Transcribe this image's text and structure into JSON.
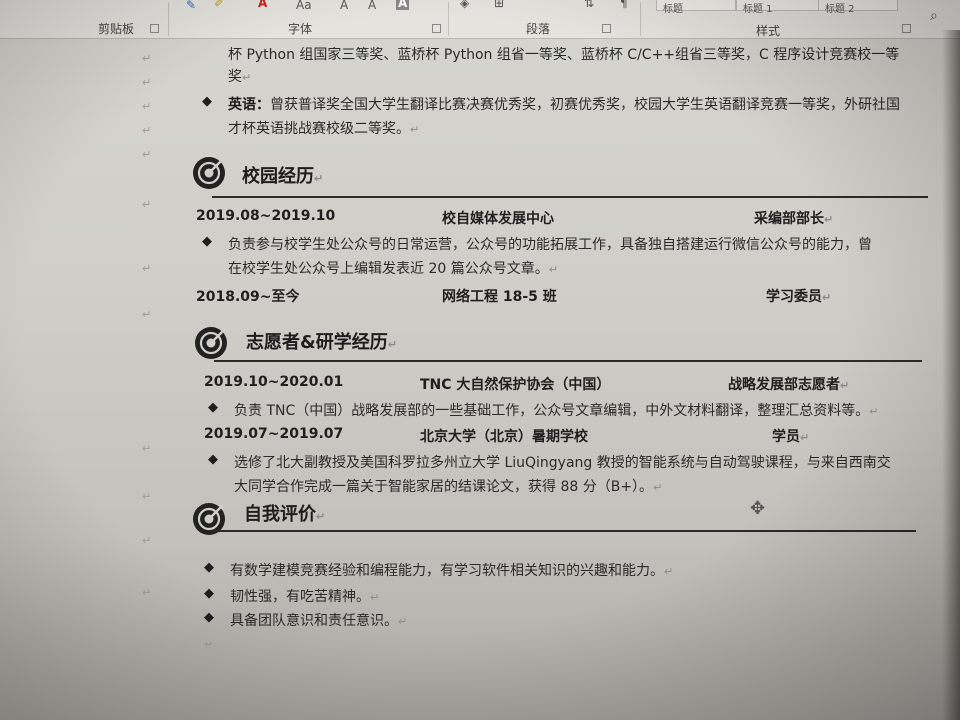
{
  "ribbon": {
    "clipboard_label": "剪贴板",
    "font_label": "字体",
    "paragraph_label": "段落",
    "styles_label": "样式",
    "font_size_tool": "Aa",
    "grow_font": "A",
    "shrink_font": "A",
    "styles": [
      "标题",
      "标题 1",
      "标题 2"
    ]
  },
  "awards": {
    "line1": "杯 Python 组国家三等奖、蓝桥杯 Python 组省一等奖、蓝桥杯 C/C++组省三等奖，C 程序设计竞赛校一等",
    "line2": "奖",
    "english_label": "英语：",
    "english_line1": "曾获普译奖全国大学生翻译比赛决赛优秀奖，初赛优秀奖，校园大学生英语翻译竞赛一等奖，外研社国",
    "english_line2": "才杯英语挑战赛校级二等奖。"
  },
  "campus": {
    "heading": "校园经历",
    "entries": [
      {
        "date": "2019.08~2019.10",
        "org": "校自媒体发展中心",
        "role": "采编部部长",
        "desc_line1": "负责参与校学生处公众号的日常运营，公众号的功能拓展工作，具备独自搭建运行微信公众号的能力，曾",
        "desc_line2": "在校学生处公众号上编辑发表近 20 篇公众号文章。"
      },
      {
        "date": "2018.09~至今",
        "org": "网络工程 18-5 班",
        "role": "学习委员"
      }
    ]
  },
  "volunteer": {
    "heading": "志愿者&研学经历",
    "entries": [
      {
        "date": "2019.10~2020.01",
        "org": "TNC 大自然保护协会（中国）",
        "role": "战略发展部志愿者",
        "desc_line1": "负责 TNC（中国）战略发展部的一些基础工作，公众号文章编辑，中外文材料翻译，整理汇总资料等。"
      },
      {
        "date": "2019.07~2019.07",
        "org": "北京大学（北京）暑期学校",
        "role": "学员",
        "desc_line1": "选修了北大副教授及美国科罗拉多州立大学 LiuQingyang 教授的智能系统与自动驾驶课程，与来自西南交",
        "desc_line2": "大同学合作完成一篇关于智能家居的结课论文，获得 88 分（B+）。"
      }
    ]
  },
  "self_eval": {
    "heading": "自我评价",
    "items": [
      "有数学建模竞赛经验和编程能力，有学习软件相关知识的兴趣和能力。",
      "韧性强，有吃苦精神。",
      "具备团队意识和责任意识。"
    ]
  },
  "symbols": {
    "bullet": "◆",
    "paragraph_mark": "↵",
    "line_mark": "↵"
  },
  "colors": {
    "text": "#262626",
    "heading_icon": "#222222",
    "spell_underline": "#d23b3b",
    "grammar_underline": "#3d6ad1"
  }
}
